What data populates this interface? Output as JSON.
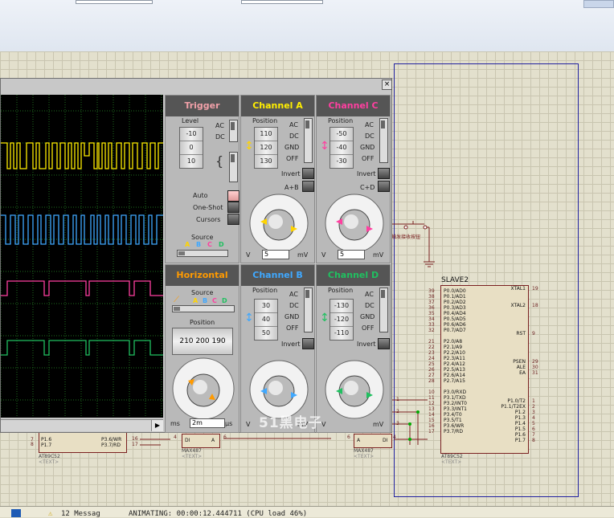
{
  "status_bar": {
    "messages": "12 Messag",
    "animating": "ANIMATING: 00:00:12.444711 (CPU load 46%)"
  },
  "oscilloscope": {
    "close_label": "×",
    "trigger": {
      "title": "Trigger",
      "level_label": "Level",
      "level_values": [
        "-10",
        "0",
        "10"
      ],
      "coupling": [
        "AC",
        "DC"
      ],
      "buttons": [
        "Auto",
        "One-Shot",
        "Cursors"
      ],
      "source_label": "Source",
      "sources": [
        "A",
        "B",
        "C",
        "D"
      ]
    },
    "channel_a": {
      "title": "Channel A",
      "position_label": "Position",
      "position_values": [
        "110",
        "120",
        "130"
      ],
      "coupling": [
        "AC",
        "DC",
        "GND",
        "OFF"
      ],
      "invert": "Invert",
      "combine": "A+B",
      "dial_value": "5",
      "unit_left": "V",
      "unit_right": "mV"
    },
    "channel_c": {
      "title": "Channel C",
      "position_label": "Position",
      "position_values": [
        "-50",
        "-40",
        "-30"
      ],
      "coupling": [
        "AC",
        "DC",
        "GND",
        "OFF"
      ],
      "invert": "Invert",
      "combine": "C+D",
      "dial_value": "5",
      "unit_left": "V",
      "unit_right": "mV"
    },
    "horizontal": {
      "title": "Horizontal",
      "source_label": "Source",
      "sources": [
        "A",
        "B",
        "C",
        "D"
      ],
      "position_label": "Position",
      "position_values": [
        "210",
        "200",
        "190"
      ],
      "dial_value": "2m",
      "unit_left": "ms",
      "unit_right": "μs"
    },
    "channel_b": {
      "title": "Channel B",
      "position_label": "Position",
      "position_values": [
        "30",
        "40",
        "50"
      ],
      "coupling": [
        "AC",
        "DC",
        "GND",
        "OFF"
      ],
      "invert": "Invert",
      "dial_value": "5",
      "unit_left": "V",
      "unit_right": "mV"
    },
    "channel_d": {
      "title": "Channel D",
      "position_label": "Position",
      "position_values": [
        "-130",
        "-120",
        "-110"
      ],
      "coupling": [
        "AC",
        "DC",
        "GND",
        "OFF"
      ],
      "invert": "Invert",
      "dial_value": "5",
      "unit_left": "V",
      "unit_right": "mV"
    },
    "colors": {
      "trigger": "#f0a0a8",
      "channel_a": "#ffee00",
      "channel_c": "#ff3fa0",
      "horizontal": "#ff9a00",
      "channel_b": "#3fa8ff",
      "channel_d": "#20c060"
    }
  },
  "schematic": {
    "slave2": {
      "title": "SLAVE2",
      "part": "AT89C52",
      "text": "<TEXT>",
      "left_pins": [
        "P0.0/AD0",
        "P0.1/AD1",
        "P0.2/AD2",
        "P0.3/AD3",
        "P0.4/AD4",
        "P0.5/AD5",
        "P0.6/AD6",
        "P0.7/AD7",
        "",
        "P2.0/A8",
        "P2.1/A9",
        "P2.2/A10",
        "P2.3/A11",
        "P2.4/A12",
        "P2.5/A13",
        "P2.6/A14",
        "P2.7/A15",
        "",
        "P3.0/RXD",
        "P3.1/TXD",
        "P3.2/INT0",
        "P3.3/INT1",
        "P3.4/T0",
        "P3.5/T1",
        "P3.6/WR",
        "P3.7/RD"
      ],
      "left_nums": [
        "39",
        "38",
        "37",
        "36",
        "35",
        "34",
        "33",
        "32",
        "",
        "21",
        "22",
        "23",
        "24",
        "25",
        "26",
        "27",
        "28",
        "",
        "10",
        "11",
        "12",
        "13",
        "14",
        "15",
        "16",
        "17"
      ],
      "right_pins": [
        "XTAL1",
        "XTAL2",
        "RST",
        "PSEN",
        "ALE",
        "EA",
        "P1.0/T2",
        "P1.1/T2EX",
        "P1.2",
        "P1.3",
        "P1.4",
        "P1.5",
        "P1.6",
        "P1.7"
      ],
      "right_nums": [
        "19",
        "18",
        "9",
        "29",
        "30",
        "31",
        "1",
        "2",
        "3",
        "4",
        "5",
        "6",
        "7",
        "8"
      ]
    },
    "button_label": "触发接收按钮",
    "max487_left": {
      "part": "MAX487",
      "text": "<TEXT>",
      "pins": [
        "DI",
        "A"
      ],
      "nums": [
        "4",
        "6"
      ]
    },
    "max487_right": {
      "part": "MAX487",
      "text": "<TEXT>",
      "pins": [
        "A",
        "DI"
      ],
      "nums": [
        "6",
        "4"
      ]
    },
    "master": {
      "part": "AT89C52",
      "text": "<TEXT>",
      "pins": [
        "P1.6",
        "P1.7",
        "P3.6/WR",
        "P3.7/RD"
      ],
      "nums": [
        "7",
        "8",
        "16",
        "17"
      ]
    },
    "net_nums": [
      "1",
      "2",
      "3"
    ],
    "watermark": "51黑电子"
  }
}
